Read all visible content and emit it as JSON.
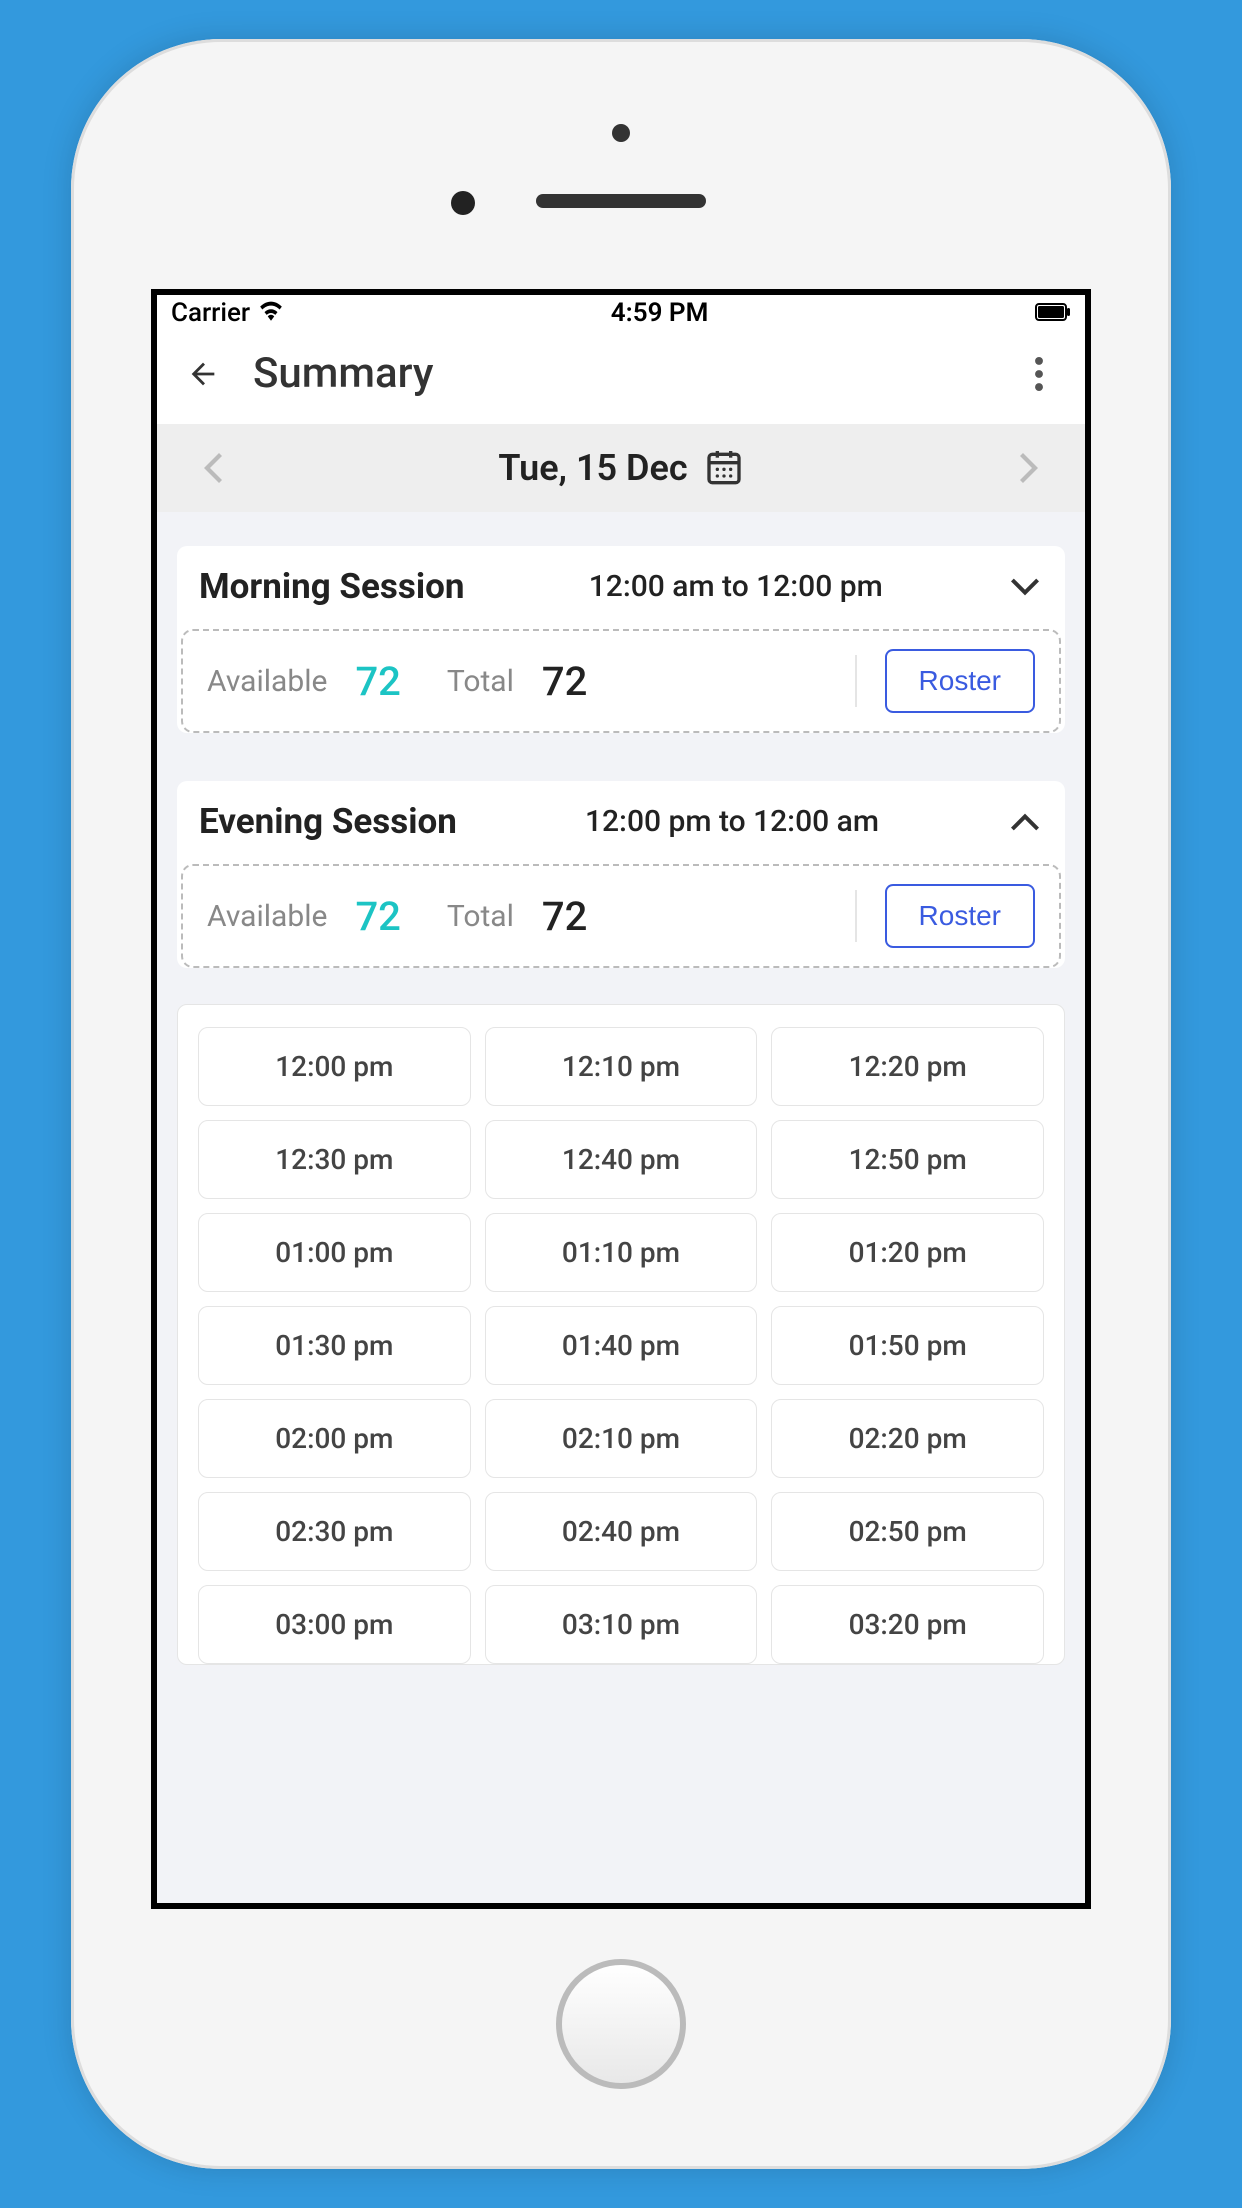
{
  "statusbar": {
    "carrier": "Carrier",
    "time": "4:59 PM"
  },
  "header": {
    "title": "Summary"
  },
  "datenav": {
    "date": "Tue, 15 Dec"
  },
  "sessions": [
    {
      "title": "Morning Session",
      "time": "12:00 am to 12:00 pm",
      "available_label": "Available",
      "available": "72",
      "total_label": "Total",
      "total": "72",
      "roster_label": "Roster",
      "expanded": false
    },
    {
      "title": "Evening Session",
      "time": "12:00 pm to 12:00 am",
      "available_label": "Available",
      "available": "72",
      "total_label": "Total",
      "total": "72",
      "roster_label": "Roster",
      "expanded": true,
      "slots": [
        "12:00 pm",
        "12:10 pm",
        "12:20 pm",
        "12:30 pm",
        "12:40 pm",
        "12:50 pm",
        "01:00 pm",
        "01:10 pm",
        "01:20 pm",
        "01:30 pm",
        "01:40 pm",
        "01:50 pm",
        "02:00 pm",
        "02:10 pm",
        "02:20 pm",
        "02:30 pm",
        "02:40 pm",
        "02:50 pm",
        "03:00 pm",
        "03:10 pm",
        "03:20 pm"
      ]
    }
  ]
}
